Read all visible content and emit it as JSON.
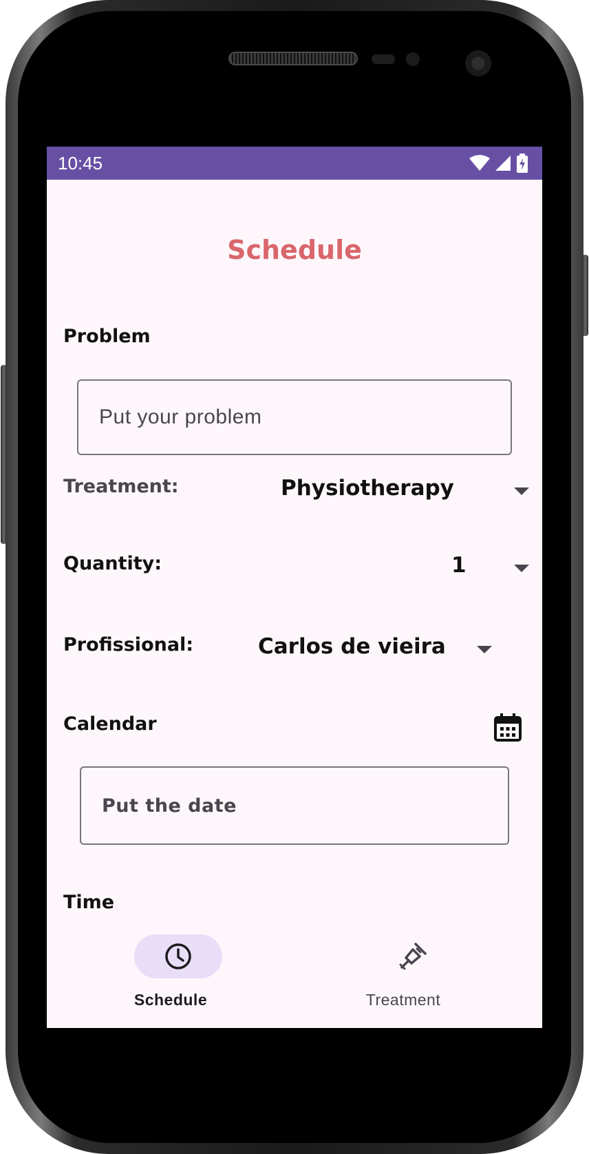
{
  "status_bar": {
    "time": "10:45",
    "icons": [
      "wifi-icon",
      "cellular-signal-icon",
      "battery-charging-icon"
    ],
    "background_color": "#6750a4"
  },
  "page": {
    "title": "Schedule",
    "title_color": "#d9666b"
  },
  "form": {
    "problem": {
      "label": "Problem",
      "placeholder": "Put your problem"
    },
    "treatment": {
      "label": "Treatment:",
      "selected": "Physiotherapy"
    },
    "quantity": {
      "label": "Quantity:",
      "selected": "1"
    },
    "professional": {
      "label": "Profissional:",
      "selected": "Carlos de vieira"
    },
    "calendar": {
      "label": "Calendar",
      "icon": "calendar-icon",
      "placeholder": "Put the date"
    },
    "time": {
      "label": "Time"
    }
  },
  "bottom_nav": {
    "items": [
      {
        "label": "Schedule",
        "icon": "clock-icon",
        "active": true
      },
      {
        "label": "Treatment",
        "icon": "crutch-icon",
        "active": false
      }
    ],
    "active_indicator_color": "#e8def8"
  }
}
